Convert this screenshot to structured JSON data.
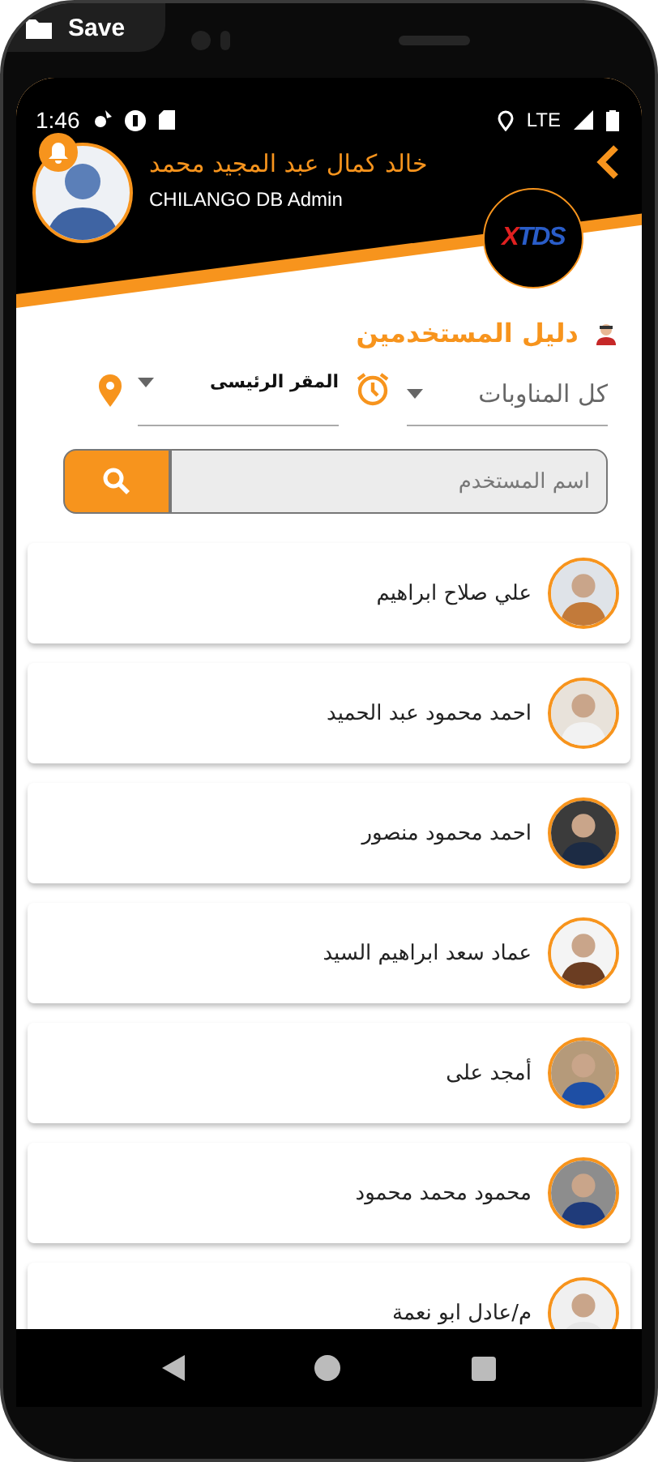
{
  "save_button": {
    "label": "Save"
  },
  "status_bar": {
    "time": "1:46",
    "network": "LTE"
  },
  "profile": {
    "name": "خالد كمال عبد المجيد  محمد",
    "role": "CHILANGO DB Admin",
    "notification": true
  },
  "logo": {
    "text": "XTDS"
  },
  "page_title": "دليل المستخدمين",
  "filters": [
    {
      "kind": "shift",
      "value": "كل المناوبات"
    },
    {
      "kind": "location",
      "value": "المقر الرئيسى"
    }
  ],
  "search": {
    "placeholder": "اسم المستخدم"
  },
  "users": [
    {
      "name": "علي صلاح ابراهيم"
    },
    {
      "name": "احمد محمود عبد الحميد"
    },
    {
      "name": "احمد محمود منصور"
    },
    {
      "name": "عماد سعد ابراهيم السيد"
    },
    {
      "name": "أمجد على"
    },
    {
      "name": "محمود محمد محمود"
    },
    {
      "name": "م/عادل ابو نعمة"
    }
  ]
}
